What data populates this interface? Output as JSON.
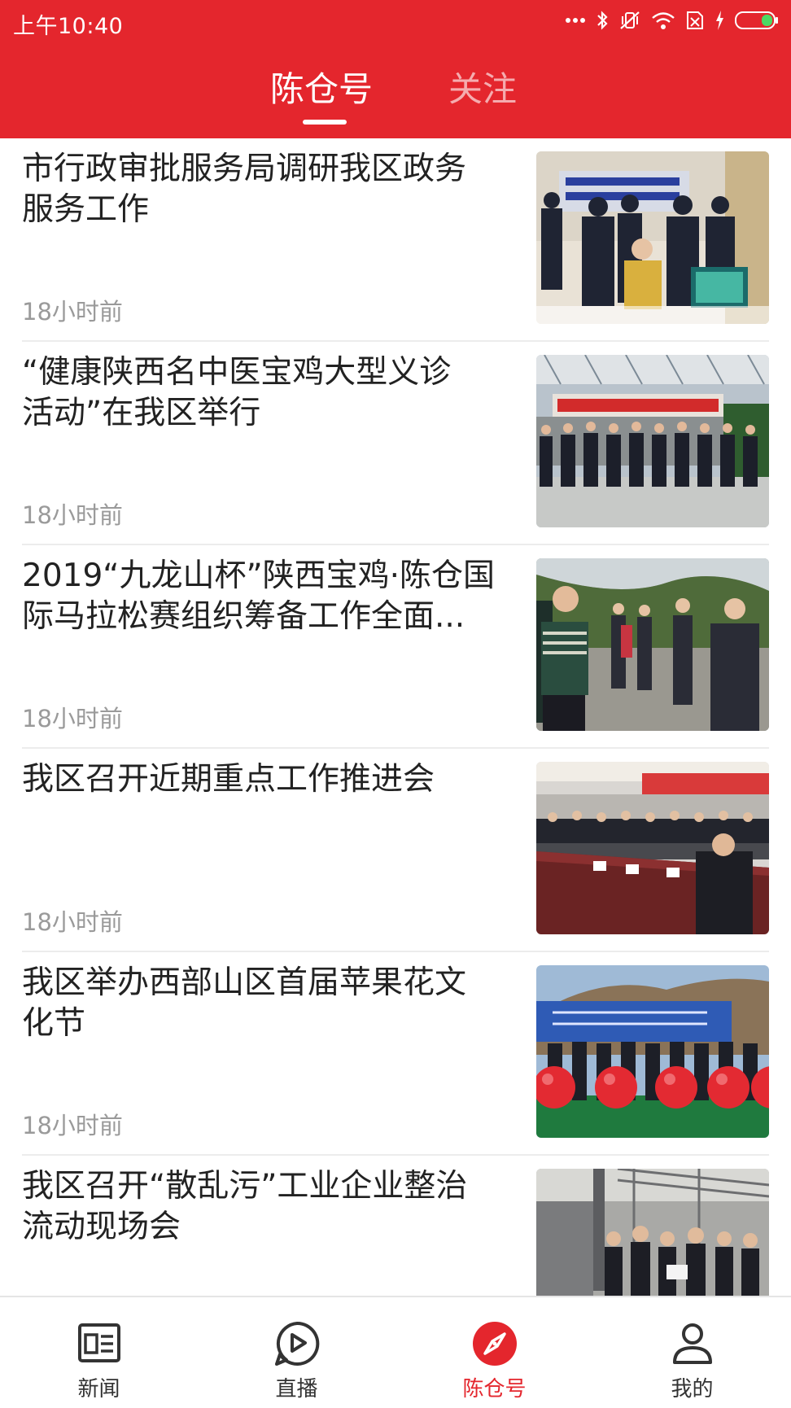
{
  "status_bar": {
    "time": "上午10:40"
  },
  "top_tabs": {
    "active": "陈仓号",
    "inactive": "关注"
  },
  "feed": [
    {
      "title": "市行政审批服务局调研我区政务\n服务工作",
      "time": "18小时前"
    },
    {
      "title": "“健康陕西名中医宝鸡大型义诊\n活动”在我区举行",
      "time": "18小时前"
    },
    {
      "title": "2019“九龙山杯”陕西宝鸡·陈仓国\n际马拉松赛组织筹备工作全面...",
      "time": "18小时前"
    },
    {
      "title": "我区召开近期重点工作推进会",
      "time": "18小时前"
    },
    {
      "title": "我区举办西部山区首届苹果花文\n化节",
      "time": "18小时前"
    },
    {
      "title": "我区召开“散乱污”工业企业整治\n流动现场会",
      "time": ""
    }
  ],
  "bottom_nav": {
    "items": [
      {
        "label": "新闻",
        "icon": "newspaper-icon"
      },
      {
        "label": "直播",
        "icon": "play-icon"
      },
      {
        "label": "陈仓号",
        "icon": "compass-icon"
      },
      {
        "label": "我的",
        "icon": "person-icon"
      }
    ],
    "active_index": 2
  },
  "colors": {
    "brand_red": "#e4262d",
    "title_text": "#222222",
    "meta_text": "#9a9a9a"
  }
}
